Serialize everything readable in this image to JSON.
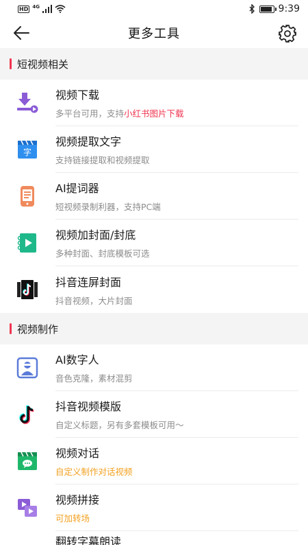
{
  "status_bar": {
    "hd": "HD",
    "net": "4G",
    "time": "9:39",
    "battery_level": 0.9
  },
  "header": {
    "title": "更多工具"
  },
  "sections": [
    {
      "title": "短视频相关",
      "items": [
        {
          "title": "视频下载",
          "subtitle_prefix": "多平台可用，支持",
          "subtitle_highlight": "小红书图片下载",
          "icon": "video-download-icon"
        },
        {
          "title": "视频提取文字",
          "subtitle": "支持链接提取和视频提取",
          "icon": "text-extract-icon"
        },
        {
          "title": "AI提词器",
          "subtitle": "短视频录制利器，支持PC端",
          "icon": "teleprompter-icon"
        },
        {
          "title": "视频加封面/封底",
          "subtitle": "多种封面、封底模板可选",
          "icon": "cover-icon"
        },
        {
          "title": "抖音连屏封面",
          "subtitle": "抖音视频，大片封面",
          "icon": "douyin-cover-icon"
        }
      ]
    },
    {
      "title": "视频制作",
      "items": [
        {
          "title": "AI数字人",
          "subtitle": "音色克隆，素材混剪",
          "icon": "digital-human-icon"
        },
        {
          "title": "抖音视频模版",
          "subtitle": "自定义标题，另有多套模板可用～",
          "icon": "douyin-icon"
        },
        {
          "title": "视频对话",
          "subtitle": "自定义制作对话视频",
          "icon": "video-chat-icon"
        },
        {
          "title": "视频拼接",
          "subtitle": "可加转场",
          "icon": "video-splice-icon"
        },
        {
          "title": "翻转字幕朗读",
          "icon": "partial-icon"
        }
      ]
    }
  ],
  "colors": {
    "accent_red": "#f0344f",
    "accent_orange": "#f2a120",
    "section_bg": "#f4f4f4"
  }
}
